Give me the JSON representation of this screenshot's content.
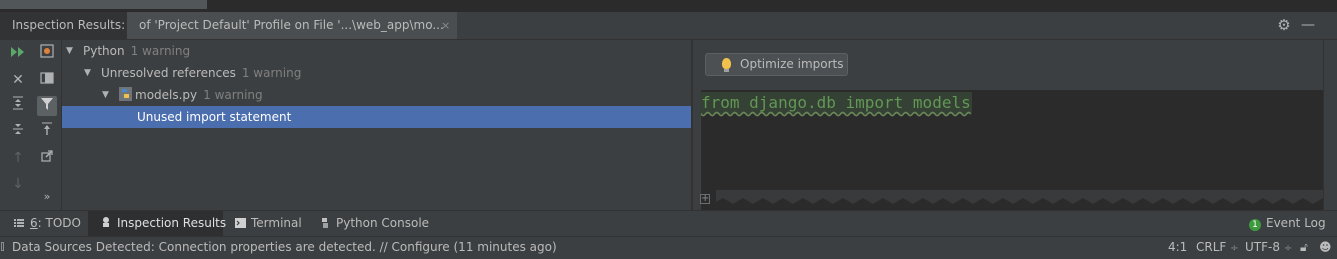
{
  "header": {
    "title": "Inspection Results:",
    "tab_label": "of 'Project Default' Profile on File '...\\web_app\\mo...",
    "tab_close": "×"
  },
  "tree": {
    "rows": [
      {
        "label": "Python",
        "count": "1 warning"
      },
      {
        "label": "Unresolved references",
        "count": "1 warning"
      },
      {
        "label": "models.py",
        "count": "1 warning"
      },
      {
        "label": "Unused import statement",
        "count": ""
      }
    ]
  },
  "preview": {
    "optimize_button": "Optimize imports",
    "code_line": "from django.db import models",
    "fold_marker": "+"
  },
  "toolwindows": {
    "todo_number": "6",
    "todo_label": ": TODO",
    "inspection": "Inspection Results",
    "terminal": "Terminal",
    "python_console": "Python Console",
    "event_log": "Event Log",
    "event_log_count": "1"
  },
  "status": {
    "message": "Data Sources Detected: Connection properties are detected. // Configure (11 minutes ago)",
    "position": "4:1",
    "line_separator": "CRLF",
    "encoding": "UTF-8"
  },
  "colors": {
    "selection": "#4b6eaf",
    "code_string": "#629755",
    "event_log_badge": "#3d9a3d"
  }
}
